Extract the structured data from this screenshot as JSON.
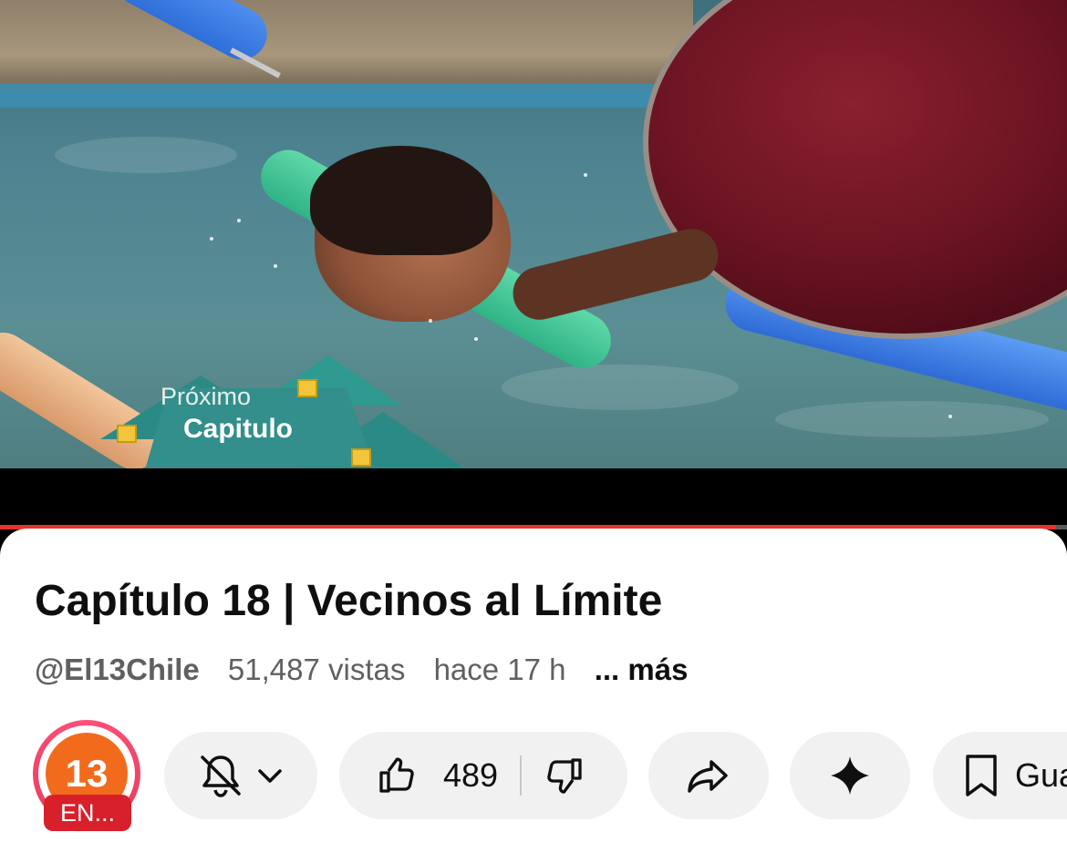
{
  "video": {
    "overlay": {
      "line1": "Próximo",
      "line2": "Capitulo"
    },
    "progress": 0.99
  },
  "details": {
    "title": "Capítulo 18 | Vecinos al Límite",
    "channel_handle": "@El13Chile",
    "views": "51,487 vistas",
    "age": "hace 17 h",
    "more": "... más"
  },
  "channel": {
    "avatar_text": "13",
    "live_badge": "EN...",
    "ring_color": "#e23b57",
    "avatar_color": "#f26b1d"
  },
  "actions": {
    "notifications_icon": "bell-off-icon",
    "like_count": "489",
    "share_icon": "share-icon",
    "ai_icon": "sparkle-icon",
    "save_label": "Gua"
  },
  "colors": {
    "accent": "#e8322d",
    "pill_bg": "#f1f1f1",
    "live_red": "#d8202c"
  }
}
